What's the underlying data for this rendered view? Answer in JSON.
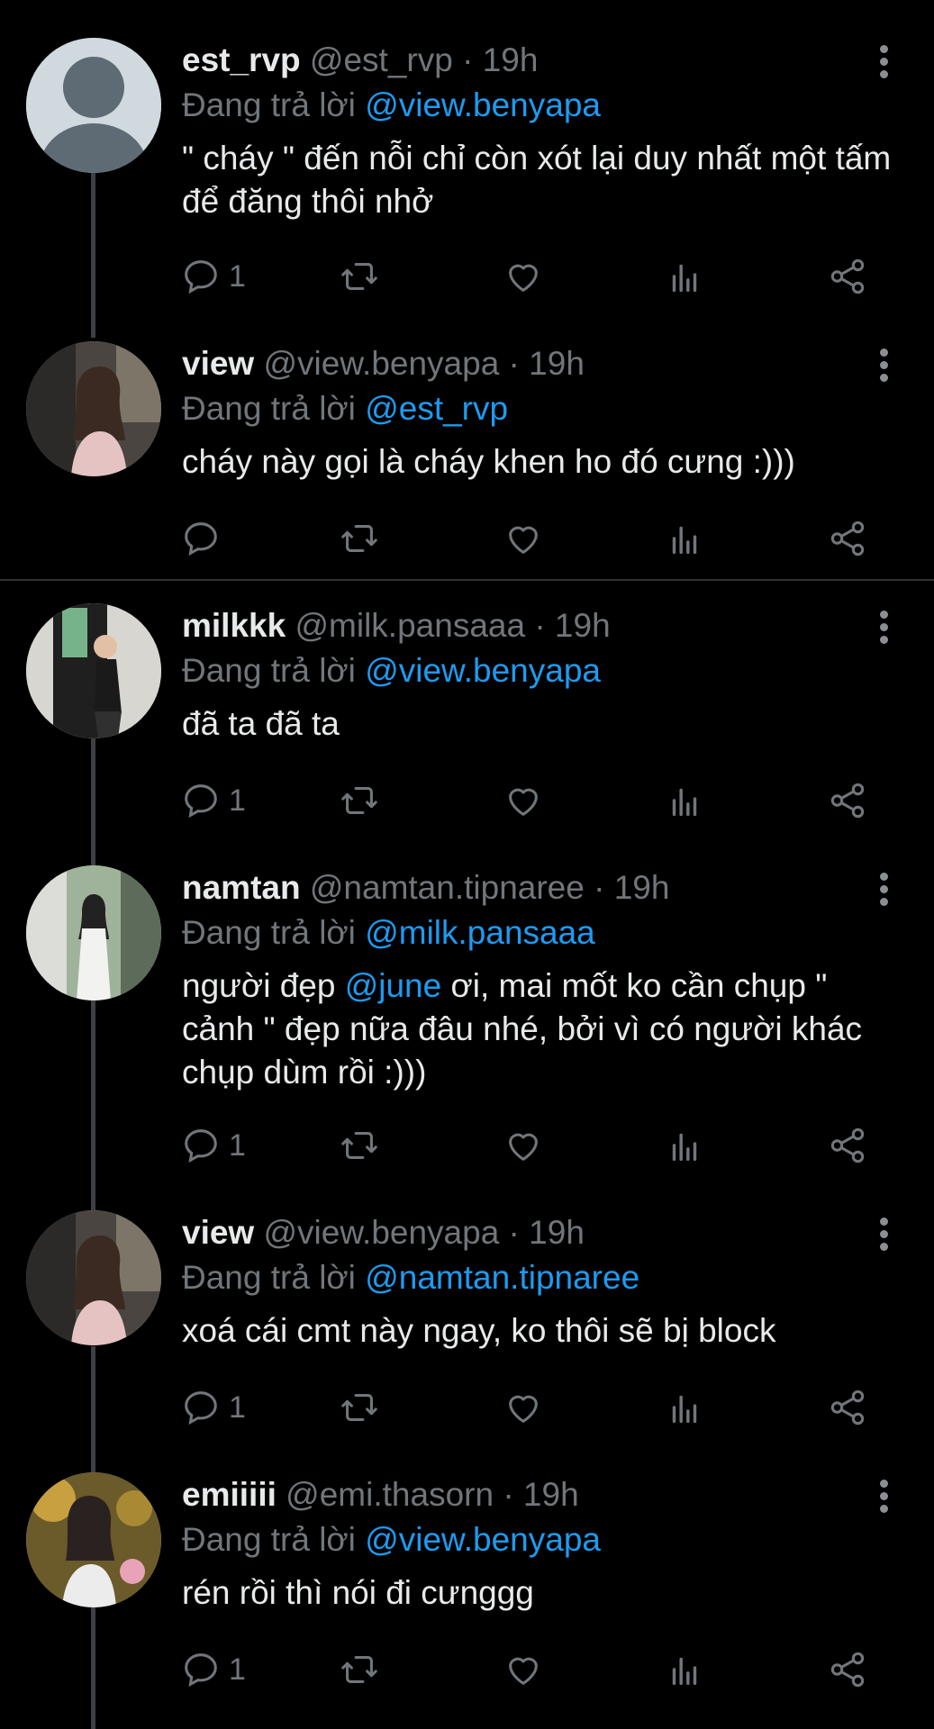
{
  "reply_prefix": "Đang trả lời",
  "tweets": [
    {
      "name": "est_rvp",
      "meta": "@est_rvp · 19h",
      "reply_to": "@view.benyapa",
      "text": "\" cháy \" đến nỗi chỉ còn xót lại duy nhất một tấm để đăng thôi nhở",
      "reply_count": "1"
    },
    {
      "name": "view",
      "meta": "@view.benyapa · 19h",
      "reply_to": "@est_rvp",
      "text": "cháy này gọi là cháy khen ho đó cưng :)))",
      "reply_count": ""
    },
    {
      "name": "milkkk",
      "meta": "@milk.pansaaa · 19h",
      "reply_to": "@view.benyapa",
      "text": "đã ta đã ta",
      "reply_count": "1"
    },
    {
      "name": "namtan",
      "meta": "@namtan.tipnaree · 19h",
      "reply_to": "@milk.pansaaa",
      "text_before": "người đẹp ",
      "text_mention": "@june",
      "text_after": " ơi, mai mốt ko cần chụp \" cảnh \" đẹp nữa đâu nhé, bởi vì có người khác chụp dùm rồi :)))",
      "reply_count": "1"
    },
    {
      "name": "view",
      "meta": "@view.benyapa · 19h",
      "reply_to": "@namtan.tipnaree",
      "text": "xoá cái cmt này ngay, ko thôi sẽ bị block",
      "reply_count": "1"
    },
    {
      "name": "emiiiii",
      "meta": "@emi.thasorn · 19h",
      "reply_to": "@view.benyapa",
      "text": "rén rồi thì nói đi cưnggg",
      "reply_count": "1"
    }
  ],
  "colors": {
    "background": "#000000",
    "text": "#e7e9ea",
    "muted": "#71767b",
    "mention": "#1d9bf0"
  },
  "icons": [
    "reply-icon",
    "retweet-icon",
    "like-icon",
    "views-icon",
    "share-icon",
    "more-icon"
  ]
}
